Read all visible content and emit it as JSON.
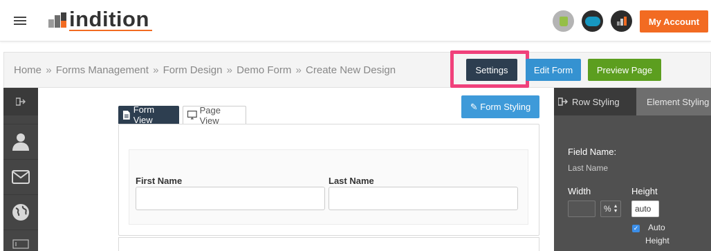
{
  "header": {
    "logo_text": "indition",
    "my_account_label": "My Account",
    "integrations": [
      "shopify-icon",
      "salesforce-icon",
      "indition-icon"
    ],
    "accent_color": "#f26b22"
  },
  "breadcrumb": {
    "items": [
      "Home",
      "Forms Management",
      "Form Design",
      "Demo Form",
      "Create New Design"
    ],
    "separator": "»"
  },
  "toolbar": {
    "settings_label": "Settings",
    "edit_form_label": "Edit Form",
    "preview_page_label": "Preview Page"
  },
  "view_tabs": {
    "form_view_label": "Form View",
    "page_view_label": "Page View",
    "active": "Form View"
  },
  "form_styling_label": "Form Styling",
  "form": {
    "fields": [
      {
        "label": "First Name",
        "value": ""
      },
      {
        "label": "Last Name",
        "value": ""
      }
    ]
  },
  "sidebar": {
    "icons": [
      "collapse-icon",
      "user-icon",
      "mail-icon",
      "globe-icon",
      "input-box-icon"
    ]
  },
  "right_panel": {
    "tabs": [
      "Row Styling",
      "Element Styling"
    ],
    "active_tab": "Element Styling",
    "field_name_label": "Field Name:",
    "field_name_value": "Last Name",
    "width_label": "Width",
    "width_value": "",
    "unit_value": "%",
    "height_label": "Height",
    "height_value": "auto",
    "auto_height_label_1": "Auto",
    "auto_height_label_2": "Height",
    "auto_height_checked": true
  }
}
